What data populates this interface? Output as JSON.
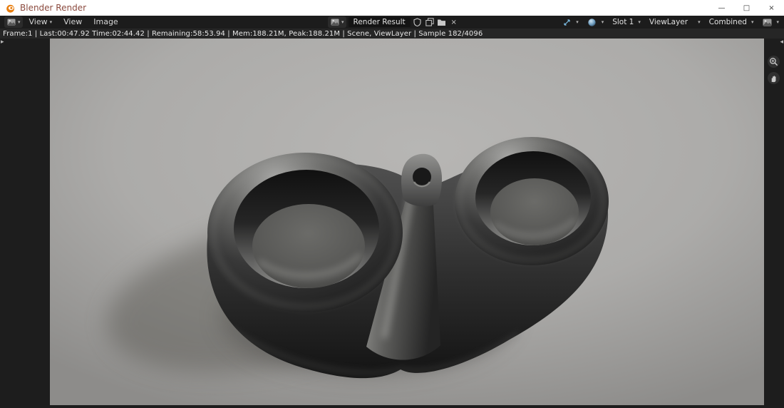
{
  "window": {
    "title": "Blender Render",
    "minimize": "—",
    "maximize": "□",
    "close": "×"
  },
  "menubar": {
    "menus": [
      {
        "label": "View",
        "has_chevron": true
      },
      {
        "label": "View",
        "has_chevron": false
      },
      {
        "label": "Image",
        "has_chevron": false
      }
    ],
    "image_name": "Render Result",
    "slot": "Slot 1",
    "layer": "ViewLayer",
    "pass": "Combined"
  },
  "statusbar": {
    "text": "Frame:1 | Last:00:47.92 Time:02:44.42 | Remaining:58:53.94 | Mem:188.21M, Peak:188.21M | Scene, ViewLayer | Sample 182/4096"
  },
  "render": {
    "subject": "dual cup holder 3D render",
    "background_color": "#aba9a7",
    "object_color": "#2e2e2e"
  },
  "colors": {
    "titlebar_bg": "#ffffff",
    "header_bg": "#1c1c1c",
    "status_bg": "#262626",
    "editor_bg": "#1d1d1d",
    "accent_orange": "#e87d0d"
  }
}
